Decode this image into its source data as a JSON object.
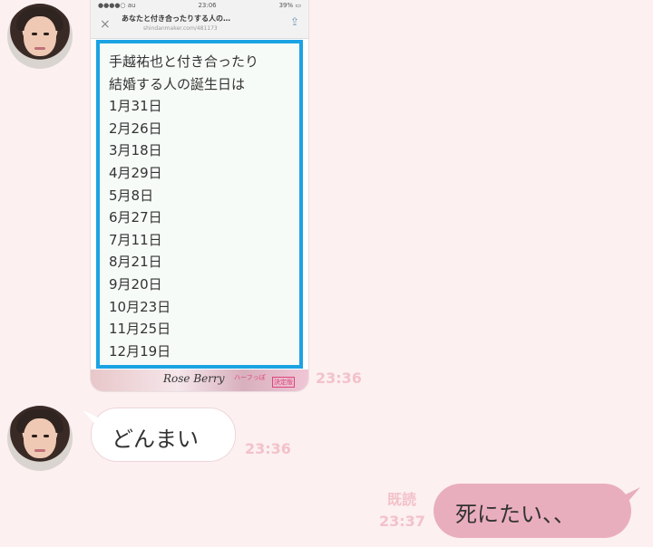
{
  "shared_image": {
    "status_time": "23:06",
    "page_title": "あなたと付き合ったりする人の…",
    "page_url": "shindanmaker.com/481173",
    "close_icon": "×",
    "share_icon": "⇪",
    "lines": [
      "手越祐也と付き合ったり",
      "結婚する人の誕生日は",
      "1月31日",
      "2月26日",
      "3月18日",
      "4月29日",
      "5月8日",
      "6月27日",
      "7月11日",
      "8月21日",
      "9月20日",
      "10月23日",
      "11月25日",
      "12月19日"
    ],
    "ad_brand": "Rose Berry",
    "ad_tag": "ハーフっぽ",
    "ad_tag2": "決定版",
    "time": "23:36"
  },
  "message_in": {
    "text": "どんまい",
    "time": "23:36"
  },
  "message_out": {
    "read_label": "既読",
    "text": "死にたい、、",
    "time": "23:37"
  },
  "colors": {
    "background": "#fcf0f1",
    "outgoing_bubble": "#e9aebe",
    "time_text": "#f3c2c9",
    "card_border": "#1ca3e3"
  }
}
